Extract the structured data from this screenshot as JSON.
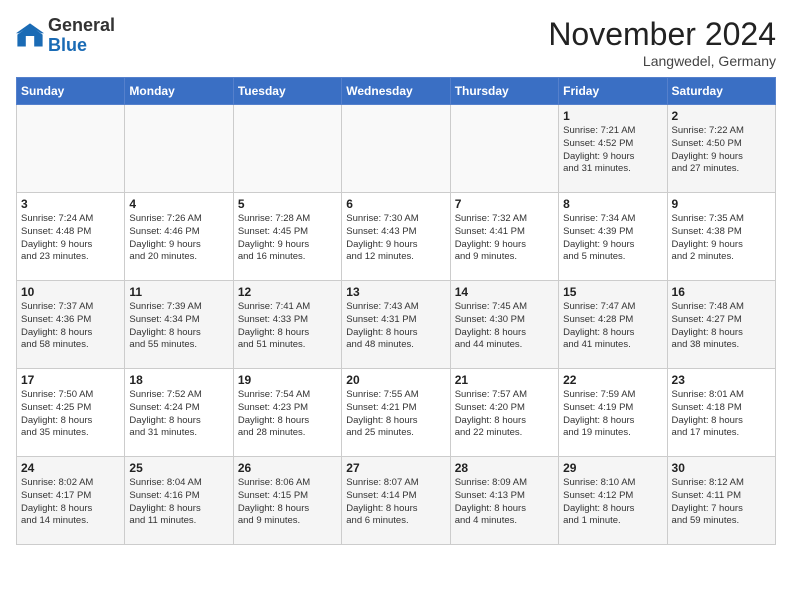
{
  "logo": {
    "general": "General",
    "blue": "Blue"
  },
  "header": {
    "month": "November 2024",
    "location": "Langwedel, Germany"
  },
  "columns": [
    "Sunday",
    "Monday",
    "Tuesday",
    "Wednesday",
    "Thursday",
    "Friday",
    "Saturday"
  ],
  "weeks": [
    [
      {
        "day": "",
        "info": ""
      },
      {
        "day": "",
        "info": ""
      },
      {
        "day": "",
        "info": ""
      },
      {
        "day": "",
        "info": ""
      },
      {
        "day": "",
        "info": ""
      },
      {
        "day": "1",
        "info": "Sunrise: 7:21 AM\nSunset: 4:52 PM\nDaylight: 9 hours\nand 31 minutes."
      },
      {
        "day": "2",
        "info": "Sunrise: 7:22 AM\nSunset: 4:50 PM\nDaylight: 9 hours\nand 27 minutes."
      }
    ],
    [
      {
        "day": "3",
        "info": "Sunrise: 7:24 AM\nSunset: 4:48 PM\nDaylight: 9 hours\nand 23 minutes."
      },
      {
        "day": "4",
        "info": "Sunrise: 7:26 AM\nSunset: 4:46 PM\nDaylight: 9 hours\nand 20 minutes."
      },
      {
        "day": "5",
        "info": "Sunrise: 7:28 AM\nSunset: 4:45 PM\nDaylight: 9 hours\nand 16 minutes."
      },
      {
        "day": "6",
        "info": "Sunrise: 7:30 AM\nSunset: 4:43 PM\nDaylight: 9 hours\nand 12 minutes."
      },
      {
        "day": "7",
        "info": "Sunrise: 7:32 AM\nSunset: 4:41 PM\nDaylight: 9 hours\nand 9 minutes."
      },
      {
        "day": "8",
        "info": "Sunrise: 7:34 AM\nSunset: 4:39 PM\nDaylight: 9 hours\nand 5 minutes."
      },
      {
        "day": "9",
        "info": "Sunrise: 7:35 AM\nSunset: 4:38 PM\nDaylight: 9 hours\nand 2 minutes."
      }
    ],
    [
      {
        "day": "10",
        "info": "Sunrise: 7:37 AM\nSunset: 4:36 PM\nDaylight: 8 hours\nand 58 minutes."
      },
      {
        "day": "11",
        "info": "Sunrise: 7:39 AM\nSunset: 4:34 PM\nDaylight: 8 hours\nand 55 minutes."
      },
      {
        "day": "12",
        "info": "Sunrise: 7:41 AM\nSunset: 4:33 PM\nDaylight: 8 hours\nand 51 minutes."
      },
      {
        "day": "13",
        "info": "Sunrise: 7:43 AM\nSunset: 4:31 PM\nDaylight: 8 hours\nand 48 minutes."
      },
      {
        "day": "14",
        "info": "Sunrise: 7:45 AM\nSunset: 4:30 PM\nDaylight: 8 hours\nand 44 minutes."
      },
      {
        "day": "15",
        "info": "Sunrise: 7:47 AM\nSunset: 4:28 PM\nDaylight: 8 hours\nand 41 minutes."
      },
      {
        "day": "16",
        "info": "Sunrise: 7:48 AM\nSunset: 4:27 PM\nDaylight: 8 hours\nand 38 minutes."
      }
    ],
    [
      {
        "day": "17",
        "info": "Sunrise: 7:50 AM\nSunset: 4:25 PM\nDaylight: 8 hours\nand 35 minutes."
      },
      {
        "day": "18",
        "info": "Sunrise: 7:52 AM\nSunset: 4:24 PM\nDaylight: 8 hours\nand 31 minutes."
      },
      {
        "day": "19",
        "info": "Sunrise: 7:54 AM\nSunset: 4:23 PM\nDaylight: 8 hours\nand 28 minutes."
      },
      {
        "day": "20",
        "info": "Sunrise: 7:55 AM\nSunset: 4:21 PM\nDaylight: 8 hours\nand 25 minutes."
      },
      {
        "day": "21",
        "info": "Sunrise: 7:57 AM\nSunset: 4:20 PM\nDaylight: 8 hours\nand 22 minutes."
      },
      {
        "day": "22",
        "info": "Sunrise: 7:59 AM\nSunset: 4:19 PM\nDaylight: 8 hours\nand 19 minutes."
      },
      {
        "day": "23",
        "info": "Sunrise: 8:01 AM\nSunset: 4:18 PM\nDaylight: 8 hours\nand 17 minutes."
      }
    ],
    [
      {
        "day": "24",
        "info": "Sunrise: 8:02 AM\nSunset: 4:17 PM\nDaylight: 8 hours\nand 14 minutes."
      },
      {
        "day": "25",
        "info": "Sunrise: 8:04 AM\nSunset: 4:16 PM\nDaylight: 8 hours\nand 11 minutes."
      },
      {
        "day": "26",
        "info": "Sunrise: 8:06 AM\nSunset: 4:15 PM\nDaylight: 8 hours\nand 9 minutes."
      },
      {
        "day": "27",
        "info": "Sunrise: 8:07 AM\nSunset: 4:14 PM\nDaylight: 8 hours\nand 6 minutes."
      },
      {
        "day": "28",
        "info": "Sunrise: 8:09 AM\nSunset: 4:13 PM\nDaylight: 8 hours\nand 4 minutes."
      },
      {
        "day": "29",
        "info": "Sunrise: 8:10 AM\nSunset: 4:12 PM\nDaylight: 8 hours\nand 1 minute."
      },
      {
        "day": "30",
        "info": "Sunrise: 8:12 AM\nSunset: 4:11 PM\nDaylight: 7 hours\nand 59 minutes."
      }
    ]
  ]
}
